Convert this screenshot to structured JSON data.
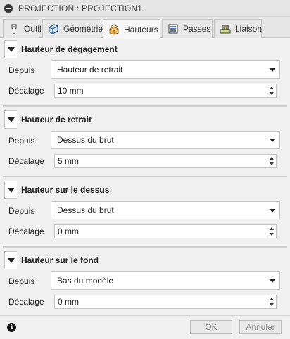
{
  "window": {
    "title": "PROJECTION : PROJECTION1"
  },
  "tabs": [
    {
      "label": "Outil",
      "icon": "tool-icon"
    },
    {
      "label": "Géométrie",
      "icon": "geometry-icon"
    },
    {
      "label": "Hauteurs",
      "icon": "heights-icon",
      "active": true
    },
    {
      "label": "Passes",
      "icon": "passes-icon"
    },
    {
      "label": "Liaison",
      "icon": "linking-icon"
    }
  ],
  "sections": [
    {
      "title": "Hauteur de dégagement",
      "from_label": "Depuis",
      "from_value": "Hauteur de retrait",
      "offset_label": "Décalage",
      "offset_value": "10 mm"
    },
    {
      "title": "Hauteur de retrait",
      "from_label": "Depuis",
      "from_value": "Dessus du brut",
      "offset_label": "Décalage",
      "offset_value": "5 mm"
    },
    {
      "title": "Hauteur sur le dessus",
      "from_label": "Depuis",
      "from_value": "Dessus du brut",
      "offset_label": "Décalage",
      "offset_value": "0 mm"
    },
    {
      "title": "Hauteur sur le fond",
      "from_label": "Depuis",
      "from_value": "Bas du modèle",
      "offset_label": "Décalage",
      "offset_value": "0 mm"
    }
  ],
  "footer": {
    "ok_label": "OK",
    "cancel_label": "Annuler"
  }
}
